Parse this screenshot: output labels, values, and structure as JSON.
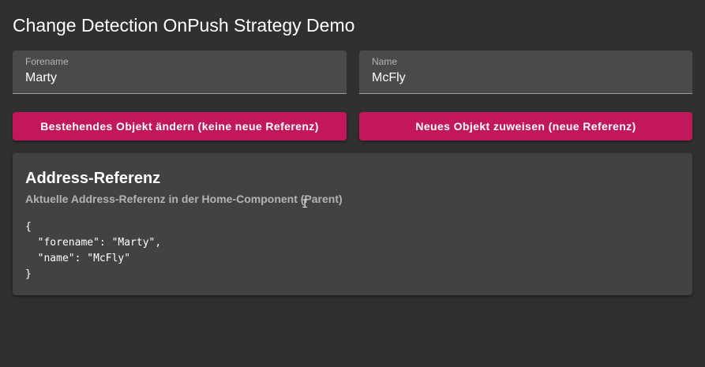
{
  "page": {
    "title": "Change Detection OnPush Strategy Demo"
  },
  "form": {
    "forename": {
      "label": "Forename",
      "value": "Marty"
    },
    "name": {
      "label": "Name",
      "value": "McFly"
    }
  },
  "actions": {
    "mutate_label": "Bestehendes Objekt ändern (keine neue Referenz)",
    "assign_label": "Neues Objekt zuweisen (neue Referenz)"
  },
  "card": {
    "title": "Address-Referenz",
    "subtitle": "Aktuelle Address-Referenz in der Home-Component (Parent)",
    "code": "{\n  \"forename\": \"Marty\",\n  \"name\": \"McFly\"\n}"
  },
  "colors": {
    "background": "#303030",
    "field_background": "#4a4a4a",
    "card_background": "#424242",
    "accent": "#c2185b"
  },
  "icons": {
    "cursor": "text-cursor-icon"
  }
}
